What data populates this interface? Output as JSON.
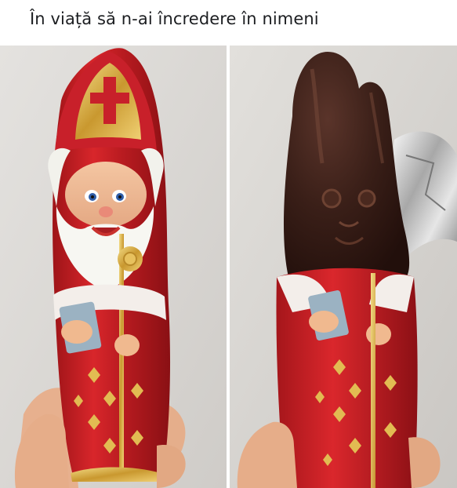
{
  "post": {
    "caption": "În viață să n-ai încredere în nimeni"
  },
  "images": {
    "left_panel": "santa-chocolate-wrapped",
    "right_panel": "bunny-chocolate-unwrapped"
  },
  "colors": {
    "foil_red": "#c81e22",
    "foil_gold": "#d8b04a",
    "chocolate": "#3a1f18",
    "background_wall": "#dcdad7"
  }
}
